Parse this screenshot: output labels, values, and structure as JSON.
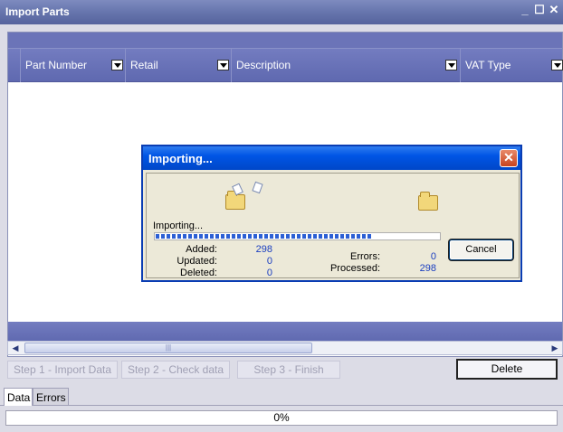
{
  "window": {
    "title": "Import Parts"
  },
  "grid": {
    "columns": [
      {
        "label": "Part Number"
      },
      {
        "label": "Retail"
      },
      {
        "label": "Description"
      },
      {
        "label": "VAT Type"
      }
    ]
  },
  "steps": [
    {
      "label": "Step 1 - Import Data"
    },
    {
      "label": "Step 2 - Check data"
    },
    {
      "label": "Step 3 - Finish"
    }
  ],
  "delete_label": "Delete",
  "tabs": [
    {
      "label": "Data"
    },
    {
      "label": "Errors"
    }
  ],
  "status_progress": {
    "text": "0%",
    "percent": 0
  },
  "dialog": {
    "title": "Importing...",
    "progress_label": "Importing...",
    "progress_fraction": 0.76,
    "stats": {
      "added_label": "Added:",
      "added_value": "298",
      "updated_label": "Updated:",
      "updated_value": "0",
      "deleted_label": "Deleted:",
      "deleted_value": "0",
      "errors_label": "Errors:",
      "errors_value": "0",
      "processed_label": "Processed:",
      "processed_value": "298"
    },
    "cancel_label": "Cancel",
    "close_icon": "close-icon"
  },
  "colors": {
    "grid_header": "#6b74b8",
    "dialog_title": "#0055e5",
    "progress_fill": "#2c5fd4",
    "value_text": "#1a3ec0"
  }
}
